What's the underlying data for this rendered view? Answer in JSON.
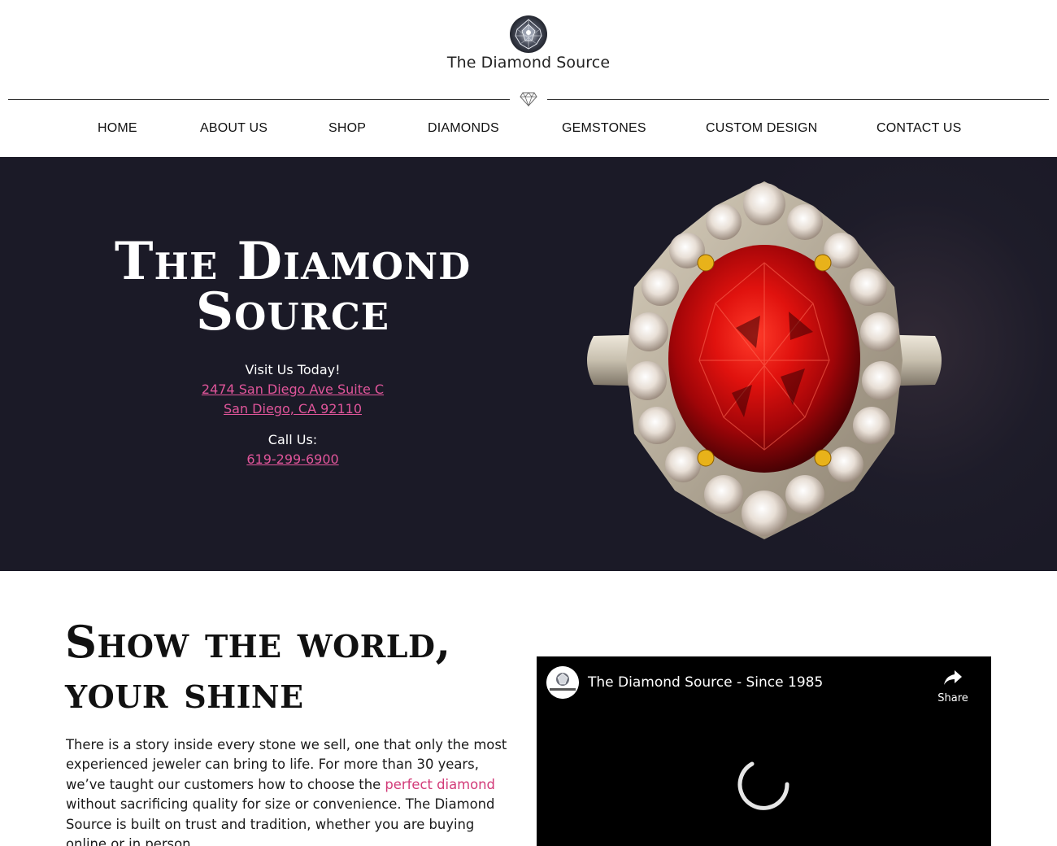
{
  "header": {
    "logo_text": "The Diamond Source",
    "logo_icon": "diamond-gem-icon",
    "divider_icon": "diamond-outline-icon"
  },
  "nav": {
    "items": [
      {
        "label": "HOME"
      },
      {
        "label": "ABOUT US"
      },
      {
        "label": "SHOP"
      },
      {
        "label": "DIAMONDS"
      },
      {
        "label": "GEMSTONES"
      },
      {
        "label": "CUSTOM DESIGN"
      },
      {
        "label": "CONTACT US"
      }
    ]
  },
  "hero": {
    "title_line1": "The Diamond",
    "title_line2": "Source",
    "visit_label": "Visit Us Today!",
    "address_line1": "2474 San Diego Ave Suite C",
    "address_line2": "San Diego, CA 92110",
    "call_label": "Call Us:",
    "phone": "619-299-6900",
    "image": "ruby-diamond-ring-image",
    "background_color": "#1b1a27",
    "link_color": "#e0559a"
  },
  "intro": {
    "title_line1": "Show the world,",
    "title_line2": "your shine",
    "body_before": "There is a story inside every stone we sell, one that only the most experienced jeweler can bring to life. For more than 30 years, we’ve taught our customers how to choose the ",
    "body_link": "perfect diamond",
    "body_after": " without sacrificing quality for size or convenience. The Diamond Source is built on trust and tradition, whether you are buying online or in person.",
    "link_color": "#d23a78"
  },
  "video": {
    "title": "The Diamond Source - Since 1985",
    "share_label": "Share",
    "state": "loading"
  }
}
